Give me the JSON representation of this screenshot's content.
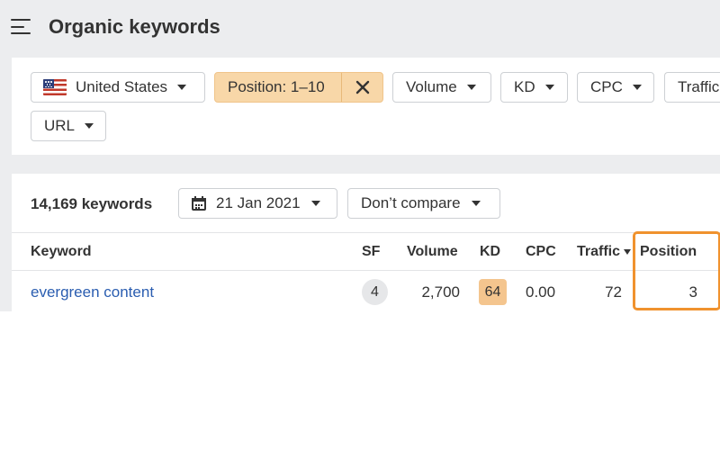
{
  "header": {
    "title": "Organic keywords",
    "menu_icon": "hamburger-menu-icon"
  },
  "filters": {
    "country": "United States",
    "position": "Position: 1–10",
    "position_clear": "✕",
    "volume": "Volume",
    "kd": "KD",
    "cpc": "CPC",
    "traffic": "Traffic",
    "url": "URL"
  },
  "summary": {
    "keyword_count": "14,169 keywords",
    "date": "21 Jan 2021",
    "compare": "Don’t compare"
  },
  "table": {
    "columns": {
      "keyword": "Keyword",
      "sf": "SF",
      "volume": "Volume",
      "kd": "KD",
      "cpc": "CPC",
      "traffic": "Traffic",
      "position": "Position"
    },
    "rows": [
      {
        "keyword": "evergreen content",
        "sf": "4",
        "volume": "2,700",
        "kd": "64",
        "cpc": "0.00",
        "traffic": "72",
        "position": "3"
      }
    ]
  },
  "colors": {
    "highlight": "#f0922e",
    "link": "#2a5db0",
    "position_filter_bg": "#f8d7a8",
    "kd_badge": "#f4c58e"
  }
}
